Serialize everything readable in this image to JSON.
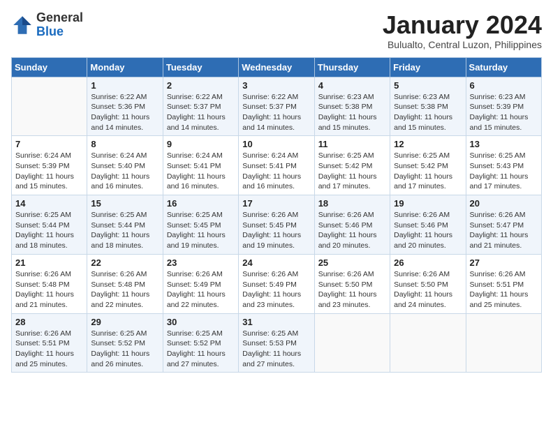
{
  "logo": {
    "general": "General",
    "blue": "Blue"
  },
  "title": "January 2024",
  "subtitle": "Bulualto, Central Luzon, Philippines",
  "days_header": [
    "Sunday",
    "Monday",
    "Tuesday",
    "Wednesday",
    "Thursday",
    "Friday",
    "Saturday"
  ],
  "weeks": [
    [
      {
        "day": "",
        "info": ""
      },
      {
        "day": "1",
        "info": "Sunrise: 6:22 AM\nSunset: 5:36 PM\nDaylight: 11 hours\nand 14 minutes."
      },
      {
        "day": "2",
        "info": "Sunrise: 6:22 AM\nSunset: 5:37 PM\nDaylight: 11 hours\nand 14 minutes."
      },
      {
        "day": "3",
        "info": "Sunrise: 6:22 AM\nSunset: 5:37 PM\nDaylight: 11 hours\nand 14 minutes."
      },
      {
        "day": "4",
        "info": "Sunrise: 6:23 AM\nSunset: 5:38 PM\nDaylight: 11 hours\nand 15 minutes."
      },
      {
        "day": "5",
        "info": "Sunrise: 6:23 AM\nSunset: 5:38 PM\nDaylight: 11 hours\nand 15 minutes."
      },
      {
        "day": "6",
        "info": "Sunrise: 6:23 AM\nSunset: 5:39 PM\nDaylight: 11 hours\nand 15 minutes."
      }
    ],
    [
      {
        "day": "7",
        "info": "Sunrise: 6:24 AM\nSunset: 5:39 PM\nDaylight: 11 hours\nand 15 minutes."
      },
      {
        "day": "8",
        "info": "Sunrise: 6:24 AM\nSunset: 5:40 PM\nDaylight: 11 hours\nand 16 minutes."
      },
      {
        "day": "9",
        "info": "Sunrise: 6:24 AM\nSunset: 5:41 PM\nDaylight: 11 hours\nand 16 minutes."
      },
      {
        "day": "10",
        "info": "Sunrise: 6:24 AM\nSunset: 5:41 PM\nDaylight: 11 hours\nand 16 minutes."
      },
      {
        "day": "11",
        "info": "Sunrise: 6:25 AM\nSunset: 5:42 PM\nDaylight: 11 hours\nand 17 minutes."
      },
      {
        "day": "12",
        "info": "Sunrise: 6:25 AM\nSunset: 5:42 PM\nDaylight: 11 hours\nand 17 minutes."
      },
      {
        "day": "13",
        "info": "Sunrise: 6:25 AM\nSunset: 5:43 PM\nDaylight: 11 hours\nand 17 minutes."
      }
    ],
    [
      {
        "day": "14",
        "info": "Sunrise: 6:25 AM\nSunset: 5:44 PM\nDaylight: 11 hours\nand 18 minutes."
      },
      {
        "day": "15",
        "info": "Sunrise: 6:25 AM\nSunset: 5:44 PM\nDaylight: 11 hours\nand 18 minutes."
      },
      {
        "day": "16",
        "info": "Sunrise: 6:25 AM\nSunset: 5:45 PM\nDaylight: 11 hours\nand 19 minutes."
      },
      {
        "day": "17",
        "info": "Sunrise: 6:26 AM\nSunset: 5:45 PM\nDaylight: 11 hours\nand 19 minutes."
      },
      {
        "day": "18",
        "info": "Sunrise: 6:26 AM\nSunset: 5:46 PM\nDaylight: 11 hours\nand 20 minutes."
      },
      {
        "day": "19",
        "info": "Sunrise: 6:26 AM\nSunset: 5:46 PM\nDaylight: 11 hours\nand 20 minutes."
      },
      {
        "day": "20",
        "info": "Sunrise: 6:26 AM\nSunset: 5:47 PM\nDaylight: 11 hours\nand 21 minutes."
      }
    ],
    [
      {
        "day": "21",
        "info": "Sunrise: 6:26 AM\nSunset: 5:48 PM\nDaylight: 11 hours\nand 21 minutes."
      },
      {
        "day": "22",
        "info": "Sunrise: 6:26 AM\nSunset: 5:48 PM\nDaylight: 11 hours\nand 22 minutes."
      },
      {
        "day": "23",
        "info": "Sunrise: 6:26 AM\nSunset: 5:49 PM\nDaylight: 11 hours\nand 22 minutes."
      },
      {
        "day": "24",
        "info": "Sunrise: 6:26 AM\nSunset: 5:49 PM\nDaylight: 11 hours\nand 23 minutes."
      },
      {
        "day": "25",
        "info": "Sunrise: 6:26 AM\nSunset: 5:50 PM\nDaylight: 11 hours\nand 23 minutes."
      },
      {
        "day": "26",
        "info": "Sunrise: 6:26 AM\nSunset: 5:50 PM\nDaylight: 11 hours\nand 24 minutes."
      },
      {
        "day": "27",
        "info": "Sunrise: 6:26 AM\nSunset: 5:51 PM\nDaylight: 11 hours\nand 25 minutes."
      }
    ],
    [
      {
        "day": "28",
        "info": "Sunrise: 6:26 AM\nSunset: 5:51 PM\nDaylight: 11 hours\nand 25 minutes."
      },
      {
        "day": "29",
        "info": "Sunrise: 6:25 AM\nSunset: 5:52 PM\nDaylight: 11 hours\nand 26 minutes."
      },
      {
        "day": "30",
        "info": "Sunrise: 6:25 AM\nSunset: 5:52 PM\nDaylight: 11 hours\nand 27 minutes."
      },
      {
        "day": "31",
        "info": "Sunrise: 6:25 AM\nSunset: 5:53 PM\nDaylight: 11 hours\nand 27 minutes."
      },
      {
        "day": "",
        "info": ""
      },
      {
        "day": "",
        "info": ""
      },
      {
        "day": "",
        "info": ""
      }
    ]
  ]
}
